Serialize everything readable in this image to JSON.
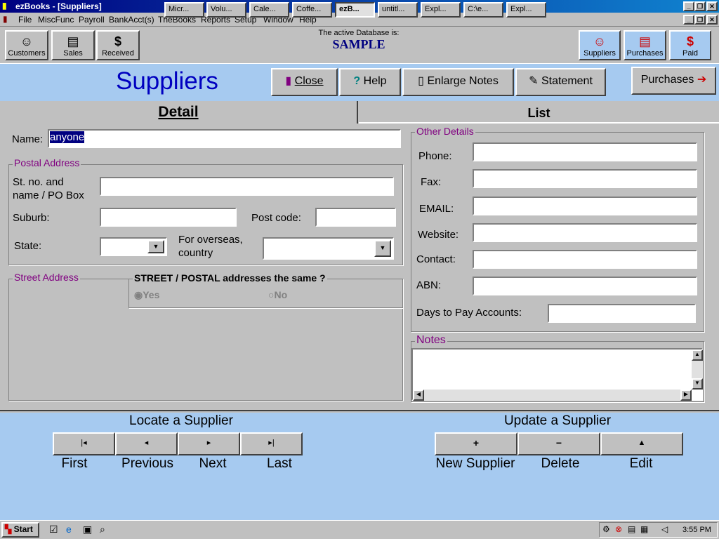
{
  "window": {
    "title": "ezBooks - [Suppliers]"
  },
  "menu": [
    "File",
    "MiscFunc",
    "Payroll",
    "BankAcct(s)",
    "TheBooks",
    "Reports",
    "Setup",
    "Window",
    "Help"
  ],
  "toolbar": {
    "customers": "Customers",
    "sales": "Sales",
    "received": "Received",
    "db_caption": "The active Database is:",
    "db_name": "SAMPLE",
    "suppliers": "Suppliers",
    "purchases": "Purchases",
    "paid": "Paid"
  },
  "page": {
    "title": "Suppliers",
    "close": "Close",
    "help": "Help",
    "enlarge_notes": "Enlarge Notes",
    "statement": "Statement",
    "purchases": "Purchases"
  },
  "tabs": {
    "detail": "Detail",
    "list": "List"
  },
  "form": {
    "name_label": "Name:",
    "name_value": "anyone",
    "postal_group": "Postal Address",
    "street_label_1": "St. no. and",
    "street_label_2": "name / PO Box",
    "suburb_label": "Suburb:",
    "postcode_label": "Post code:",
    "state_label": "State:",
    "overseas_label_1": "For overseas,",
    "overseas_label_2": "country",
    "street_group": "Street Address",
    "same_question": "STREET / POSTAL addresses the same ?",
    "yes": "Yes",
    "no": "No",
    "other_group": "Other Details",
    "phone_label": "Phone:",
    "fax_label": "Fax:",
    "email_label": "EMAIL:",
    "website_label": "Website:",
    "contact_label": "Contact:",
    "abn_label": "ABN:",
    "days_label": "Days to Pay Accounts:",
    "notes_group": "Notes"
  },
  "locate": {
    "title": "Locate a Supplier",
    "first": "First",
    "previous": "Previous",
    "next": "Next",
    "last": "Last"
  },
  "update": {
    "title": "Update a Supplier",
    "new": "New Supplier",
    "delete": "Delete",
    "edit": "Edit"
  },
  "taskbar": {
    "start": "Start",
    "tasks": [
      "Micr...",
      "Volu...",
      "Cale...",
      "Coffe...",
      "ezB...",
      "untitl...",
      "Expl...",
      "C:\\e...",
      "Expl..."
    ],
    "clock": "3:55 PM"
  }
}
